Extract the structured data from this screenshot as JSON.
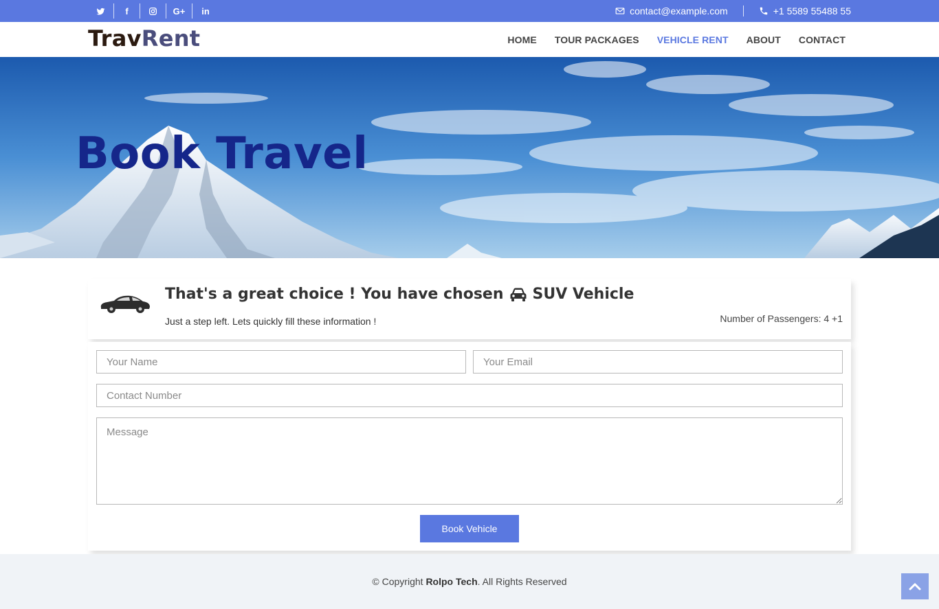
{
  "topbar": {
    "social": [
      {
        "name": "twitter-icon"
      },
      {
        "name": "facebook-icon",
        "glyph": "f"
      },
      {
        "name": "instagram-icon"
      },
      {
        "name": "google-plus-icon",
        "glyph": "G+"
      },
      {
        "name": "linkedin-icon",
        "glyph": "in"
      }
    ],
    "email": "contact@example.com",
    "phone": "+1 5589 55488 55"
  },
  "header": {
    "logo_part1": "Trav",
    "logo_part2": "Rent",
    "nav": [
      {
        "label": "HOME",
        "active": false
      },
      {
        "label": "TOUR PACKAGES",
        "active": false
      },
      {
        "label": "VEHICLE RENT",
        "active": true
      },
      {
        "label": "ABOUT",
        "active": false
      },
      {
        "label": "CONTACT",
        "active": false
      }
    ]
  },
  "hero": {
    "title": "Book Travel"
  },
  "booking": {
    "title_prefix": "That's a great choice ! You have chosen",
    "vehicle": "SUV Vehicle",
    "subtitle": "Just a step left. Lets quickly fill these information !",
    "passengers": "Number of Passengers: 4 +1"
  },
  "form": {
    "name_placeholder": "Your Name",
    "email_placeholder": "Your Email",
    "phone_placeholder": "Contact Number",
    "message_placeholder": "Message",
    "submit_label": "Book Vehicle"
  },
  "footer": {
    "copy_prefix": "© Copyright ",
    "company": "Rolpo Tech",
    "copy_suffix": ". All Rights Reserved"
  },
  "colors": {
    "accent": "#5a78e0",
    "hero_title": "#15268a",
    "footer_bg": "#f0f3f7"
  }
}
